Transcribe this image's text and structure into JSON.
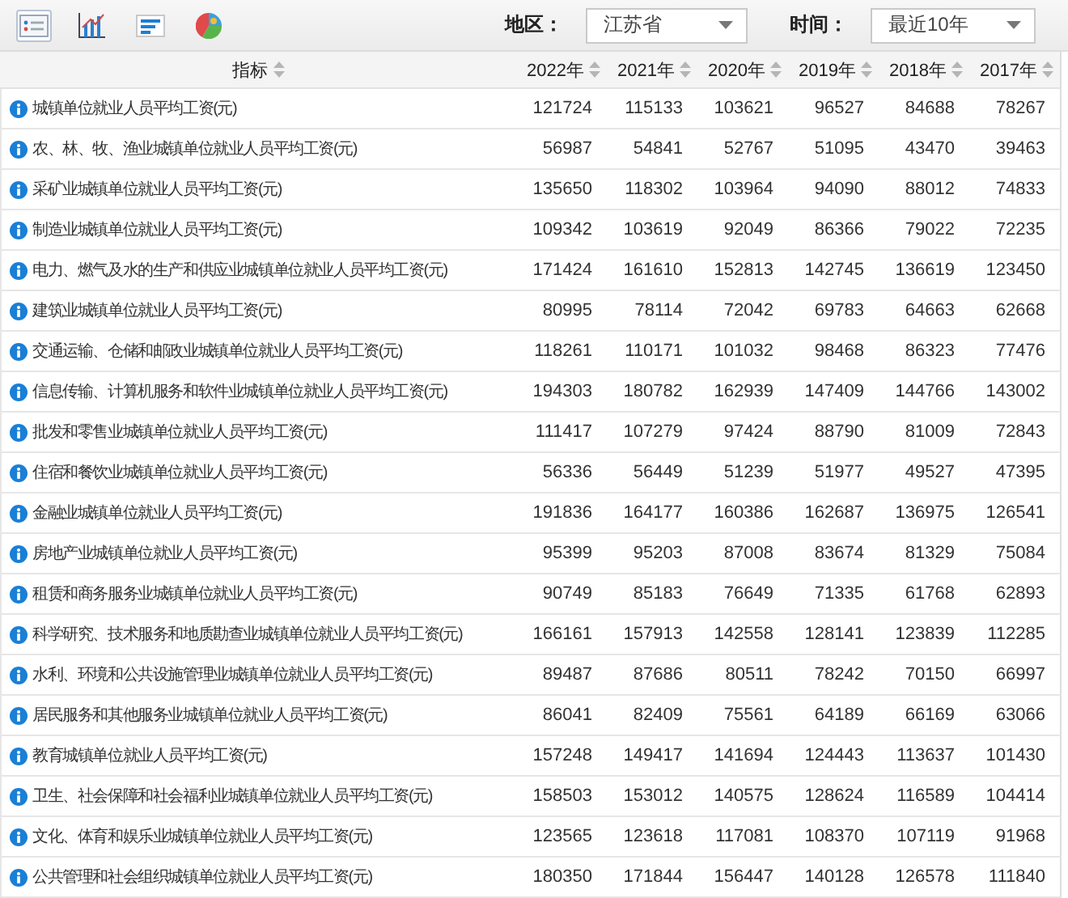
{
  "toolbar": {
    "views": [
      {
        "kind": "table",
        "selected": true
      },
      {
        "kind": "bar",
        "selected": false
      },
      {
        "kind": "hbar",
        "selected": false
      },
      {
        "kind": "pie",
        "selected": false
      }
    ],
    "filters": [
      {
        "label": "地区：",
        "value": "江苏省"
      },
      {
        "label": "时间：",
        "value": "最近10年"
      }
    ]
  },
  "table": {
    "columns": [
      "指标",
      "2022年",
      "2021年",
      "2020年",
      "2019年",
      "2018年",
      "2017年"
    ],
    "rows": [
      {
        "name": "城镇单位就业人员平均工资(元)",
        "values": [
          "121724",
          "115133",
          "103621",
          "96527",
          "84688",
          "78267"
        ]
      },
      {
        "name": "农、林、牧、渔业城镇单位就业人员平均工资(元)",
        "values": [
          "56987",
          "54841",
          "52767",
          "51095",
          "43470",
          "39463"
        ]
      },
      {
        "name": "采矿业城镇单位就业人员平均工资(元)",
        "values": [
          "135650",
          "118302",
          "103964",
          "94090",
          "88012",
          "74833"
        ]
      },
      {
        "name": "制造业城镇单位就业人员平均工资(元)",
        "values": [
          "109342",
          "103619",
          "92049",
          "86366",
          "79022",
          "72235"
        ]
      },
      {
        "name": "电力、燃气及水的生产和供应业城镇单位就业人员平均工资(元)",
        "values": [
          "171424",
          "161610",
          "152813",
          "142745",
          "136619",
          "123450"
        ]
      },
      {
        "name": "建筑业城镇单位就业人员平均工资(元)",
        "values": [
          "80995",
          "78114",
          "72042",
          "69783",
          "64663",
          "62668"
        ]
      },
      {
        "name": "交通运输、仓储和邮政业城镇单位就业人员平均工资(元)",
        "values": [
          "118261",
          "110171",
          "101032",
          "98468",
          "86323",
          "77476"
        ]
      },
      {
        "name": "信息传输、计算机服务和软件业城镇单位就业人员平均工资(元)",
        "values": [
          "194303",
          "180782",
          "162939",
          "147409",
          "144766",
          "143002"
        ]
      },
      {
        "name": "批发和零售业城镇单位就业人员平均工资(元)",
        "values": [
          "111417",
          "107279",
          "97424",
          "88790",
          "81009",
          "72843"
        ]
      },
      {
        "name": "住宿和餐饮业城镇单位就业人员平均工资(元)",
        "values": [
          "56336",
          "56449",
          "51239",
          "51977",
          "49527",
          "47395"
        ]
      },
      {
        "name": "金融业城镇单位就业人员平均工资(元)",
        "values": [
          "191836",
          "164177",
          "160386",
          "162687",
          "136975",
          "126541"
        ]
      },
      {
        "name": "房地产业城镇单位就业人员平均工资(元)",
        "values": [
          "95399",
          "95203",
          "87008",
          "83674",
          "81329",
          "75084"
        ]
      },
      {
        "name": "租赁和商务服务业城镇单位就业人员平均工资(元)",
        "values": [
          "90749",
          "85183",
          "76649",
          "71335",
          "61768",
          "62893"
        ]
      },
      {
        "name": "科学研究、技术服务和地质勘查业城镇单位就业人员平均工资(元)",
        "values": [
          "166161",
          "157913",
          "142558",
          "128141",
          "123839",
          "112285"
        ]
      },
      {
        "name": "水利、环境和公共设施管理业城镇单位就业人员平均工资(元)",
        "values": [
          "89487",
          "87686",
          "80511",
          "78242",
          "70150",
          "66997"
        ]
      },
      {
        "name": "居民服务和其他服务业城镇单位就业人员平均工资(元)",
        "values": [
          "86041",
          "82409",
          "75561",
          "64189",
          "66169",
          "63066"
        ]
      },
      {
        "name": "教育城镇单位就业人员平均工资(元)",
        "values": [
          "157248",
          "149417",
          "141694",
          "124443",
          "113637",
          "101430"
        ]
      },
      {
        "name": "卫生、社会保障和社会福利业城镇单位就业人员平均工资(元)",
        "values": [
          "158503",
          "153012",
          "140575",
          "128624",
          "116589",
          "104414"
        ]
      },
      {
        "name": "文化、体育和娱乐业城镇单位就业人员平均工资(元)",
        "values": [
          "123565",
          "123618",
          "117081",
          "108370",
          "107119",
          "91968"
        ]
      },
      {
        "name": "公共管理和社会组织城镇单位就业人员平均工资(元)",
        "values": [
          "180350",
          "171844",
          "156447",
          "140128",
          "126578",
          "111840"
        ]
      }
    ]
  }
}
